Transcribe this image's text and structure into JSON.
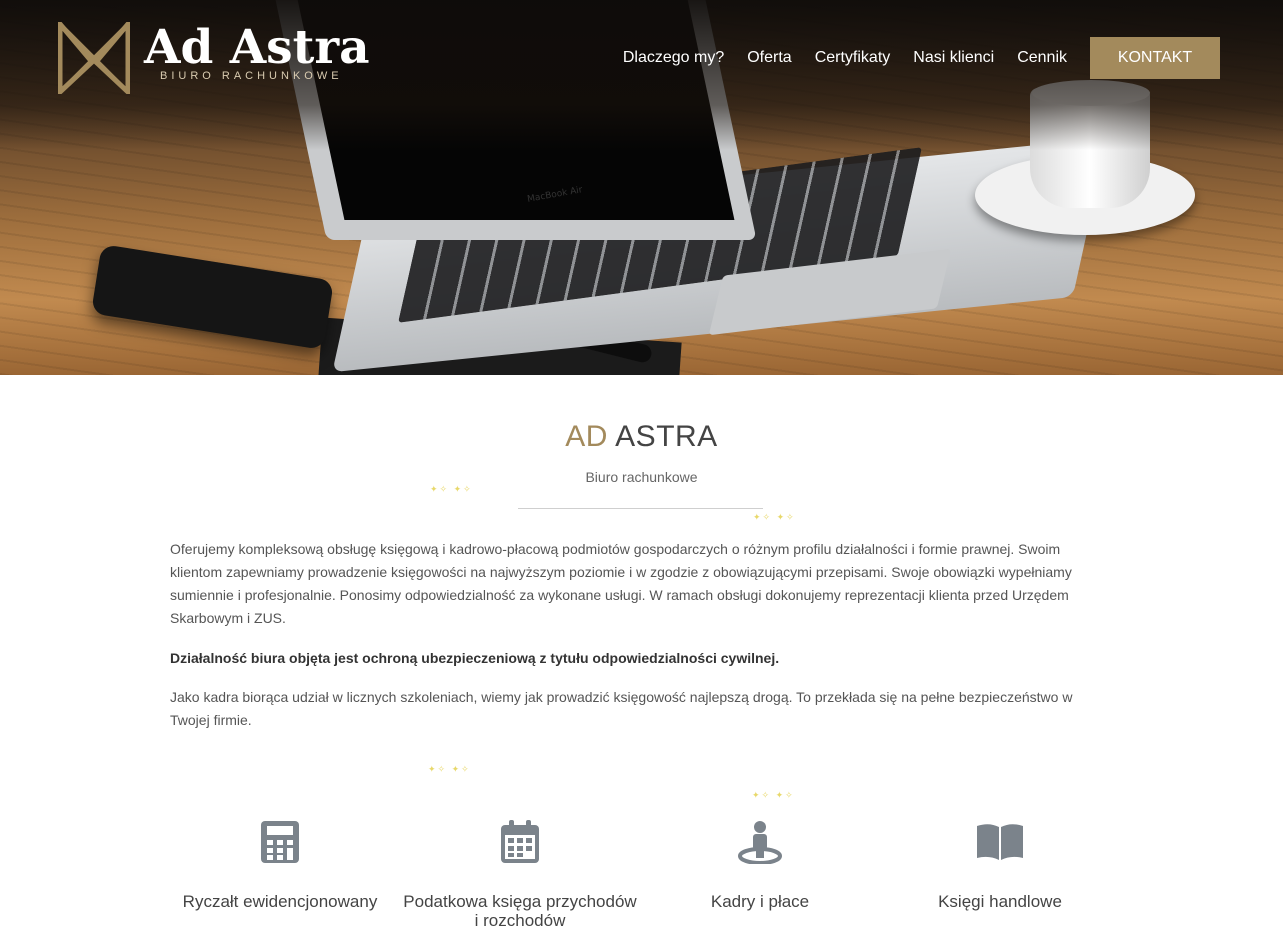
{
  "brand": {
    "title": "Ad Astra",
    "subtitle": "BIURO RACHUNKOWE",
    "accent_color": "#a38a5c"
  },
  "hero": {
    "laptop_label": "MacBook Air"
  },
  "nav": {
    "items": [
      "Dlaczego my?",
      "Oferta",
      "Certyfikaty",
      "Nasi klienci",
      "Cennik"
    ],
    "contact_label": "KONTAKT"
  },
  "intro": {
    "title_accent": "AD",
    "title_main": "ASTRA",
    "subtitle": "Biuro rachunkowe",
    "paragraph_1": "Oferujemy kompleksową obsługę księgową i kadrowo-płacową podmiotów gospodarczych o różnym profilu działalności i formie prawnej. Swoim klientom zapewniamy prowadzenie księgowości na najwyższym poziomie i w zgodzie z obowiązującymi przepisami. Swoje obowiązki wypełniamy sumiennie i profesjonalnie. Ponosimy odpowiedzialność za wykonane usługi. W ramach obsługi dokonujemy reprezentacji klienta przed Urzędem Skarbowym i ZUS.",
    "paragraph_2": "Działalność biura objęta jest ochroną ubezpieczeniową z tytułu odpowiedzialności cywilnej.",
    "paragraph_3": "Jako kadra biorąca udział w licznych szkoleniach, wiemy jak prowadzić księgowość najlepszą drogą. To przekłada się na pełne bezpieczeństwo w Twojej firmie."
  },
  "services": [
    {
      "label": "Ryczałt ewidencjonowany",
      "icon": "calculator-icon"
    },
    {
      "label": "Podatkowa księga przychodów i rozchodów",
      "icon": "calendar-icon"
    },
    {
      "label": "Kadry i płace",
      "icon": "person-pin-icon"
    },
    {
      "label": "Księgi handlowe",
      "icon": "book-icon"
    }
  ],
  "icon_color": "#7b838b"
}
